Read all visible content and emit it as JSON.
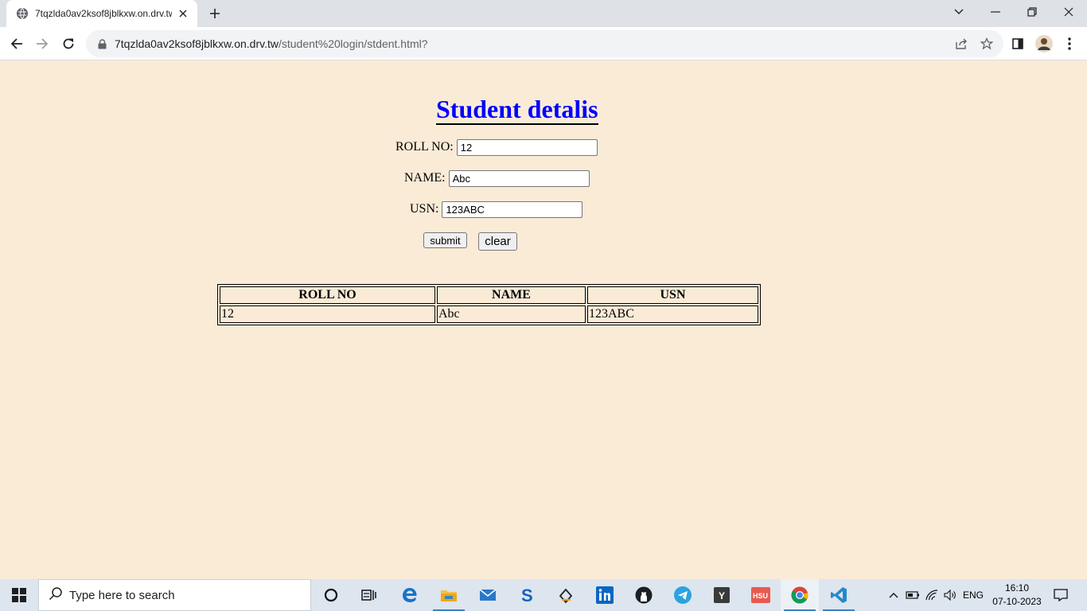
{
  "browser": {
    "tab_title": "7tqzlda0av2ksof8jblkxw.on.drv.tw",
    "url_host": "7tqzlda0av2ksof8jblkxw.on.drv.tw",
    "url_path": "/student%20login/stdent.html?"
  },
  "form": {
    "heading": "Student detalis",
    "roll_label": "ROLL NO:",
    "roll_value": "12",
    "name_label": "NAME:",
    "name_value": "Abc",
    "usn_label": "USN:",
    "usn_value": "123ABC",
    "submit_label": "submit",
    "clear_label": "clear"
  },
  "table": {
    "headers": [
      "ROLL NO",
      "NAME",
      "USN"
    ],
    "rows": [
      [
        "12",
        "Abc",
        "123ABC"
      ]
    ]
  },
  "taskbar": {
    "search_placeholder": "Type here to search",
    "language": "ENG",
    "time": "16:10",
    "date": "07-10-2023",
    "apps": [
      "cortana-icon",
      "task-view-icon",
      "edge-icon",
      "file-explorer-icon",
      "mail-icon",
      "skype-icon",
      "vlc-icon",
      "linkedin-icon",
      "github-icon",
      "telegram-icon",
      "y-app-icon",
      "hsu-app-icon",
      "chrome-icon",
      "vscode-icon"
    ]
  }
}
